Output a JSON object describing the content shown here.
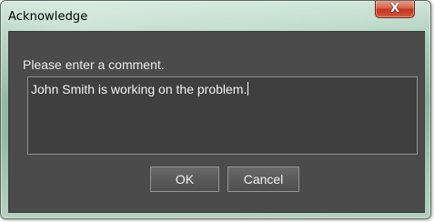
{
  "window": {
    "title": "Acknowledge",
    "close_icon": "close-icon",
    "close_glyph": "X",
    "accent_close": "#c8412a",
    "frame_color": "#9fc3ae",
    "client_bg": "#4b4b4b"
  },
  "dialog": {
    "prompt": "Please enter a comment.",
    "comment_value": "John Smith is working on the problem."
  },
  "buttons": {
    "ok_label": "OK",
    "cancel_label": "Cancel"
  }
}
